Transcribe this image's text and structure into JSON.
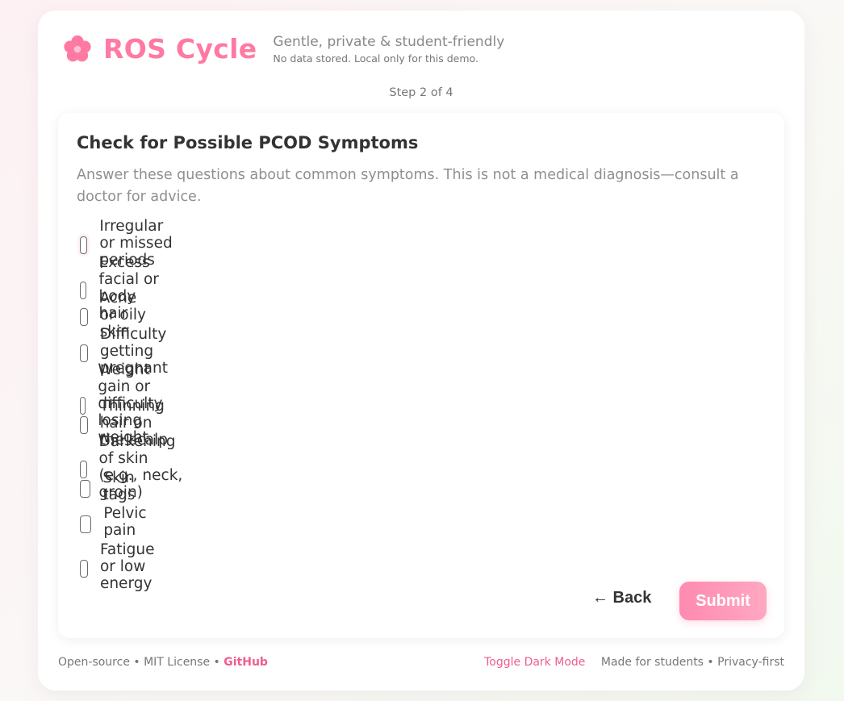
{
  "brand": {
    "name": "ROS Cycle",
    "tagline": "Gentle, private & student-friendly",
    "subtagline": "No data stored. Local only for this demo.",
    "accent": "#ff7aa2"
  },
  "step": "Step 2 of 4",
  "form": {
    "title": "Check for Possible PCOD Symptoms",
    "description": "Answer these questions about common symptoms. This is not a medical diagnosis—consult a doctor for advice.",
    "symptoms": [
      {
        "label": "Irregular or missed periods",
        "checked": false
      },
      {
        "label": "Excess facial or body hair",
        "checked": false
      },
      {
        "label": "Acne or oily skin",
        "checked": false
      },
      {
        "label": "Difficulty getting pregnant",
        "checked": false
      },
      {
        "label": "Weight gain or difficulty losing weight",
        "checked": false
      },
      {
        "label": "Thinning hair on the scalp",
        "checked": false
      },
      {
        "label": "Darkening of skin (e.g., neck, groin)",
        "checked": false
      },
      {
        "label": "Skin tags",
        "checked": false
      },
      {
        "label": "Pelvic pain",
        "checked": false
      },
      {
        "label": "Fatigue or low energy",
        "checked": false
      }
    ],
    "back_label": "← Back",
    "submit_label": "Submit"
  },
  "footer": {
    "left_text": "Open-source • MIT License •",
    "github_label": "GitHub",
    "toggle_label": "Toggle Dark Mode",
    "right_text": "Made for students • Privacy-first"
  },
  "icons": {
    "logo": "flower-icon"
  }
}
